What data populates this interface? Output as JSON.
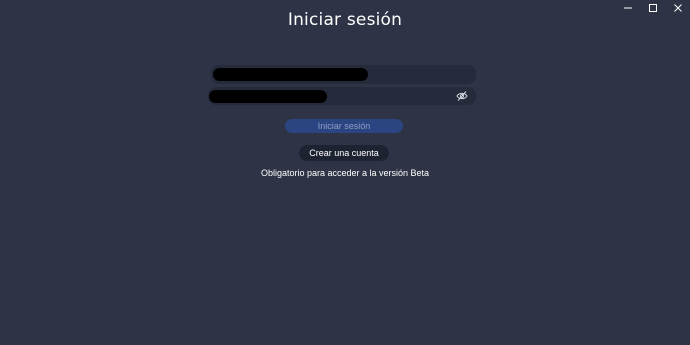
{
  "title": "Iniciar sesión",
  "window_controls": {
    "minimize_icon": "minimize-icon",
    "maximize_icon": "maximize-icon",
    "close_icon": "close-icon"
  },
  "form": {
    "username_value": "[redacted]",
    "password_value": "[redacted]",
    "visibility_icon": "eye-off-icon"
  },
  "buttons": {
    "login_label": "Iniciar sesión",
    "create_account_label": "Crear una cuenta"
  },
  "note": "Obligatorio para acceder a la versión Beta",
  "colors": {
    "background": "#2e3446",
    "field": "#252b3b",
    "login_button": "#2a4581",
    "create_button": "#1e2332"
  }
}
